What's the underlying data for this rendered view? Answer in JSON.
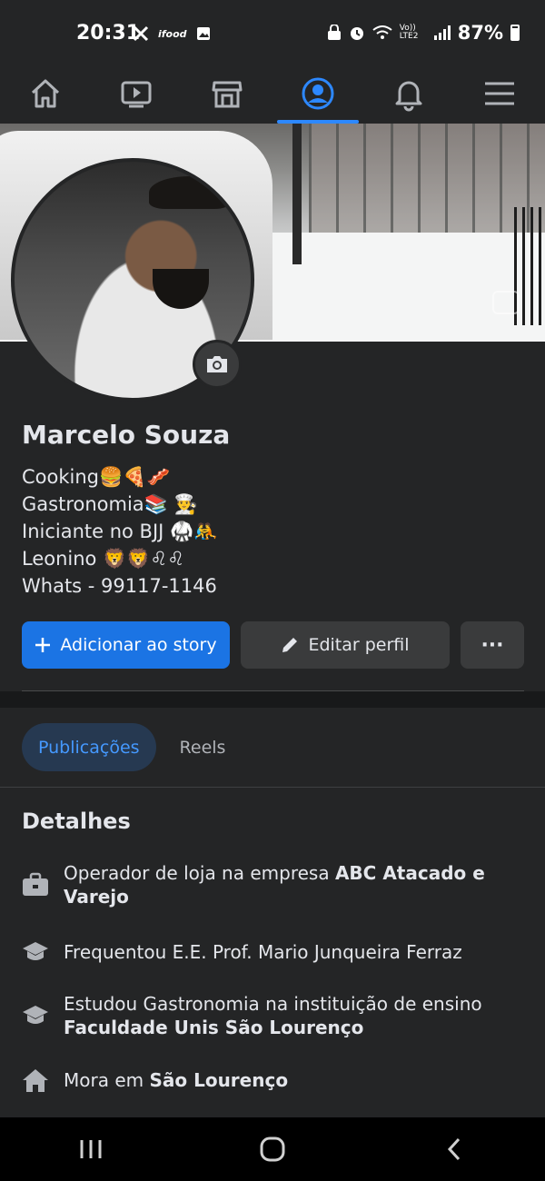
{
  "status_bar": {
    "time": "20:31",
    "left_icons": [
      "tools-icon",
      "ifood-icon",
      "image-icon"
    ],
    "network_label": "Vo)) LTE2",
    "battery": "87%"
  },
  "nav": {
    "items": [
      {
        "name": "home",
        "active": false
      },
      {
        "name": "watch",
        "active": false
      },
      {
        "name": "marketplace",
        "active": false
      },
      {
        "name": "profile",
        "active": true
      },
      {
        "name": "notifications",
        "active": false
      },
      {
        "name": "menu",
        "active": false
      }
    ]
  },
  "profile": {
    "name": "Marcelo Souza",
    "bio": [
      "Cooking🍔🍕🥓",
      "Gastronomia📚 👨‍🍳",
      "Iniciante no BJJ 🥋🤼",
      "Leonino 🦁🦁♌♌",
      "Whats -  99117-1146"
    ]
  },
  "actions": {
    "add_story": "Adicionar ao story",
    "edit_profile": "Editar perfil",
    "more": "···"
  },
  "tabs": {
    "posts": "Publicações",
    "reels": "Reels"
  },
  "details": {
    "title": "Detalhes",
    "work_prefix": "Operador de loja na empresa ",
    "work_company": "ABC Atacado e Varejo",
    "school": "Frequentou E.E. Prof. Mario Junqueira Ferraz",
    "study_prefix": "Estudou Gastronomia na instituição de ensino ",
    "study_institution": "Faculdade Unis São Lourenço",
    "lives_prefix": "Mora em ",
    "lives_city": "São Lourenço"
  },
  "colors": {
    "background": "#242526",
    "accent": "#1b74e4",
    "active_tab_text": "#4599ff"
  }
}
